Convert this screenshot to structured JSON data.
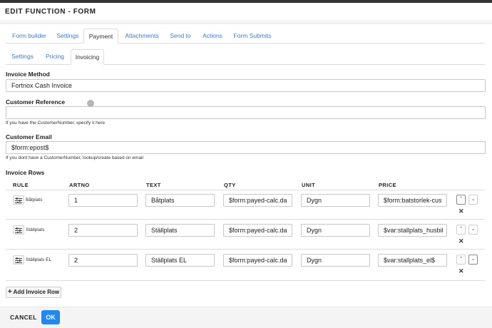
{
  "header": {
    "title": "EDIT FUNCTION - FORM"
  },
  "main_tabs": [
    {
      "label": "Form builder"
    },
    {
      "label": "Settings"
    },
    {
      "label": "Payment"
    },
    {
      "label": "Attachments"
    },
    {
      "label": "Send to"
    },
    {
      "label": "Actions"
    },
    {
      "label": "Form Submits"
    }
  ],
  "sub_tabs": [
    {
      "label": "Settings"
    },
    {
      "label": "Pricing"
    },
    {
      "label": "Invoicing"
    }
  ],
  "invoice_method": {
    "label": "Invoice Method",
    "value": "Fortnox Cash Invoice"
  },
  "customer_reference": {
    "label": "Customer Reference",
    "value": "",
    "help": "If you have the CustomerNumber, specify it here"
  },
  "customer_email": {
    "label": "Customer Email",
    "value": "$form:epost$",
    "help": "If you dont have a CustomerNumber, lookup/create based on email"
  },
  "invoice_rows": {
    "label": "Invoice Rows",
    "columns": [
      "RULE",
      "ARTNO",
      "TEXT",
      "QTY",
      "UNIT",
      "PRICE"
    ],
    "rows": [
      {
        "rule": "Båtplats",
        "artno": "1",
        "text": "Båtplats",
        "qty": "$form:payed-calc.da",
        "unit": "Dygn",
        "price": "$form:batstorlek-cus"
      },
      {
        "rule": "Ställplats",
        "artno": "2",
        "text": "Ställplats",
        "qty": "$form:payed-calc.da",
        "unit": "Dygn",
        "price": "$var:stallplats_husbil"
      },
      {
        "rule": "Ställplats EL",
        "artno": "2",
        "text": "Ställplats EL",
        "qty": "$form:payed-calc.da",
        "unit": "Dygn",
        "price": "$var:stallplats_el$"
      }
    ],
    "add_label": "Add Invoice Row",
    "icons": {
      "rule": "sliders-icon",
      "up": "chevron-up-icon",
      "down": "chevron-down-icon",
      "remove": "close-icon"
    }
  },
  "footer": {
    "cancel_label": "CANCEL",
    "ok_label": "OK"
  },
  "colors": {
    "accent": "#1e88f5",
    "link": "#3a78c9"
  }
}
